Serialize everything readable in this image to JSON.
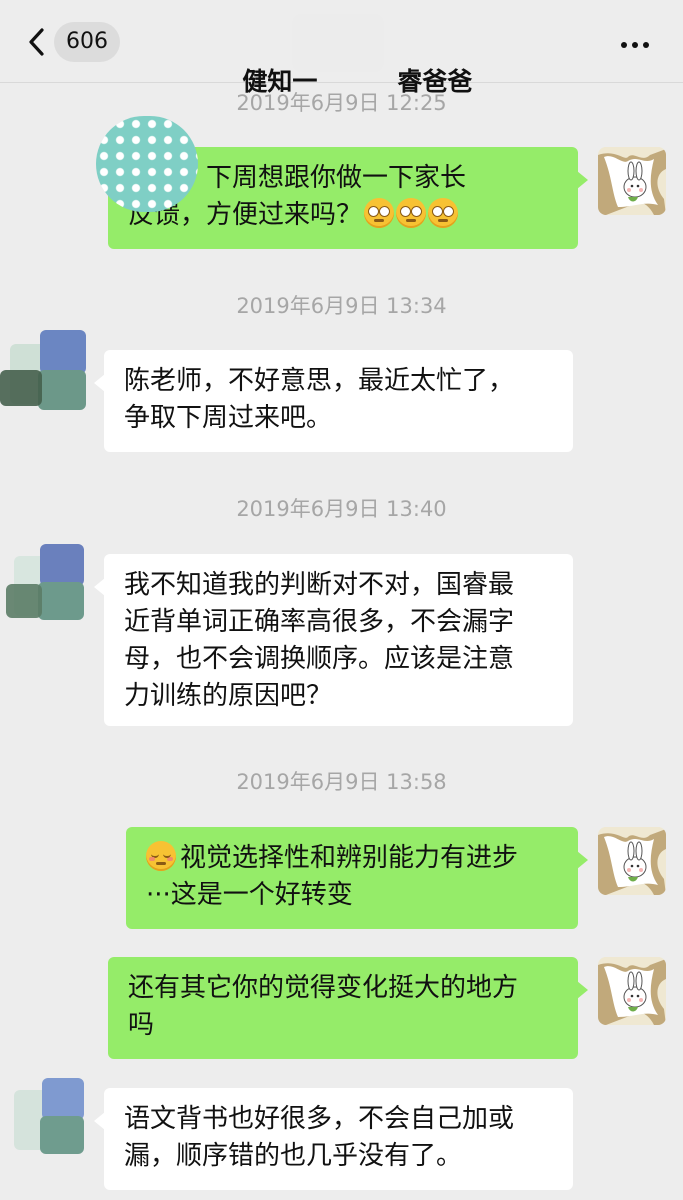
{
  "header": {
    "back_count": "606",
    "title_left": "健知一",
    "title_right": "睿爸爸"
  },
  "messages": [
    {
      "type": "time",
      "text": "2019年6月9日 12:25"
    },
    {
      "type": "me",
      "lines": [
        "爸爸，下周想跟你做一下家长",
        "反馈，方便过来吗？"
      ],
      "emoji": "flushed-face-x3"
    },
    {
      "type": "time",
      "text": "2019年6月9日 13:34"
    },
    {
      "type": "other",
      "lines": [
        "陈老师，不好意思，最近太忙了，",
        "争取下周过来吧。"
      ]
    },
    {
      "type": "time",
      "text": "2019年6月9日 13:40"
    },
    {
      "type": "other",
      "lines": [
        "我不知道我的判断对不对，国睿最",
        "近背单词正确率高很多，不会漏字",
        "母，也不会调换顺序。应该是注意",
        "力训练的原因吧？"
      ]
    },
    {
      "type": "time",
      "text": "2019年6月9日 13:58"
    },
    {
      "type": "me",
      "lines": [
        "视觉选择性和辨别能力有进步",
        "···这是一个好转变"
      ],
      "emoji": "relieved-face"
    },
    {
      "type": "me",
      "lines": [
        "还有其它你的觉得变化挺大的地方",
        "吗"
      ]
    },
    {
      "type": "other",
      "lines": [
        "语文背书也好很多，不会自己加或",
        "漏，顺序错的也几乎没有了。"
      ]
    }
  ],
  "colors": {
    "background": "#ededed",
    "my_bubble": "#95ec69",
    "other_bubble": "#ffffff",
    "timestamp": "#a6a6a6"
  }
}
